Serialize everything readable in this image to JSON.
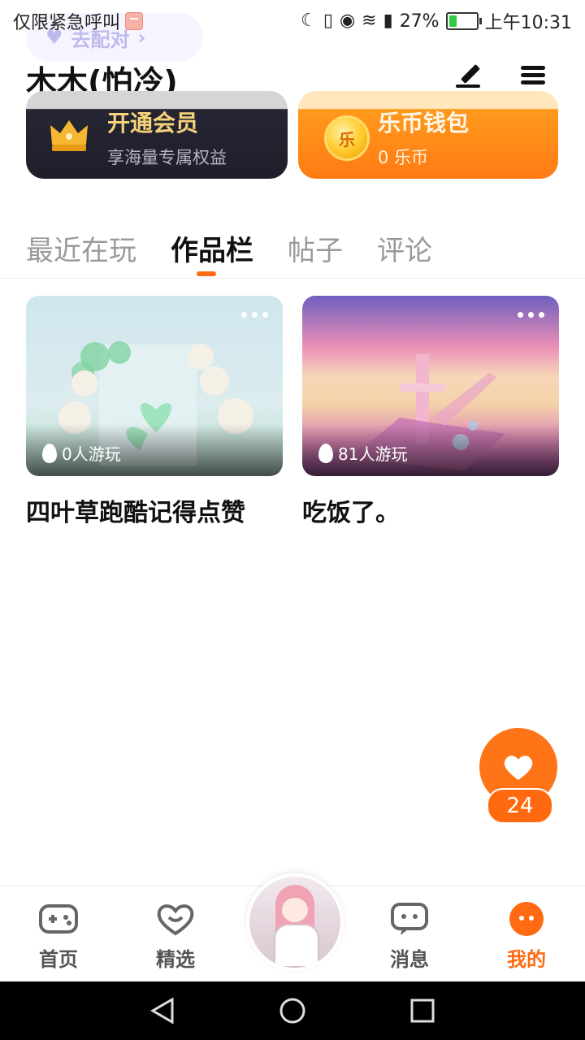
{
  "status_bar": {
    "left_text": "仅限紧急呼叫",
    "battery": "27%",
    "battery_level": 0.27,
    "time": "上午10:31"
  },
  "header": {
    "pair_button": "去配对",
    "username": "木木(怕冷)"
  },
  "vip_card": {
    "title": "开通会员",
    "subtitle": "享海量专属权益"
  },
  "wallet_card": {
    "coin_symbol": "乐",
    "title": "乐币钱包",
    "subtitle": "0 乐币"
  },
  "tabs": [
    {
      "label": "最近在玩",
      "active": false
    },
    {
      "label": "作品栏",
      "active": true
    },
    {
      "label": "帖子",
      "active": false
    },
    {
      "label": "评论",
      "active": false
    }
  ],
  "works": [
    {
      "title": "四叶草跑酷记得点赞",
      "plays": "0人游玩"
    },
    {
      "title": "吃饭了。",
      "plays": "81人游玩"
    }
  ],
  "like": {
    "count": "24"
  },
  "bottom_nav": [
    {
      "label": "首页",
      "icon": "gamepad-icon",
      "active": false
    },
    {
      "label": "精选",
      "icon": "heart-outline-icon",
      "active": false
    },
    {
      "label": "",
      "icon": "avatar",
      "active": false
    },
    {
      "label": "消息",
      "icon": "chat-icon",
      "active": false
    },
    {
      "label": "我的",
      "icon": "profile-icon",
      "active": true
    }
  ],
  "colors": {
    "accent": "#ff6a13",
    "vip_gold": "#f6d37a",
    "wallet_orange": "#ff8a18"
  }
}
